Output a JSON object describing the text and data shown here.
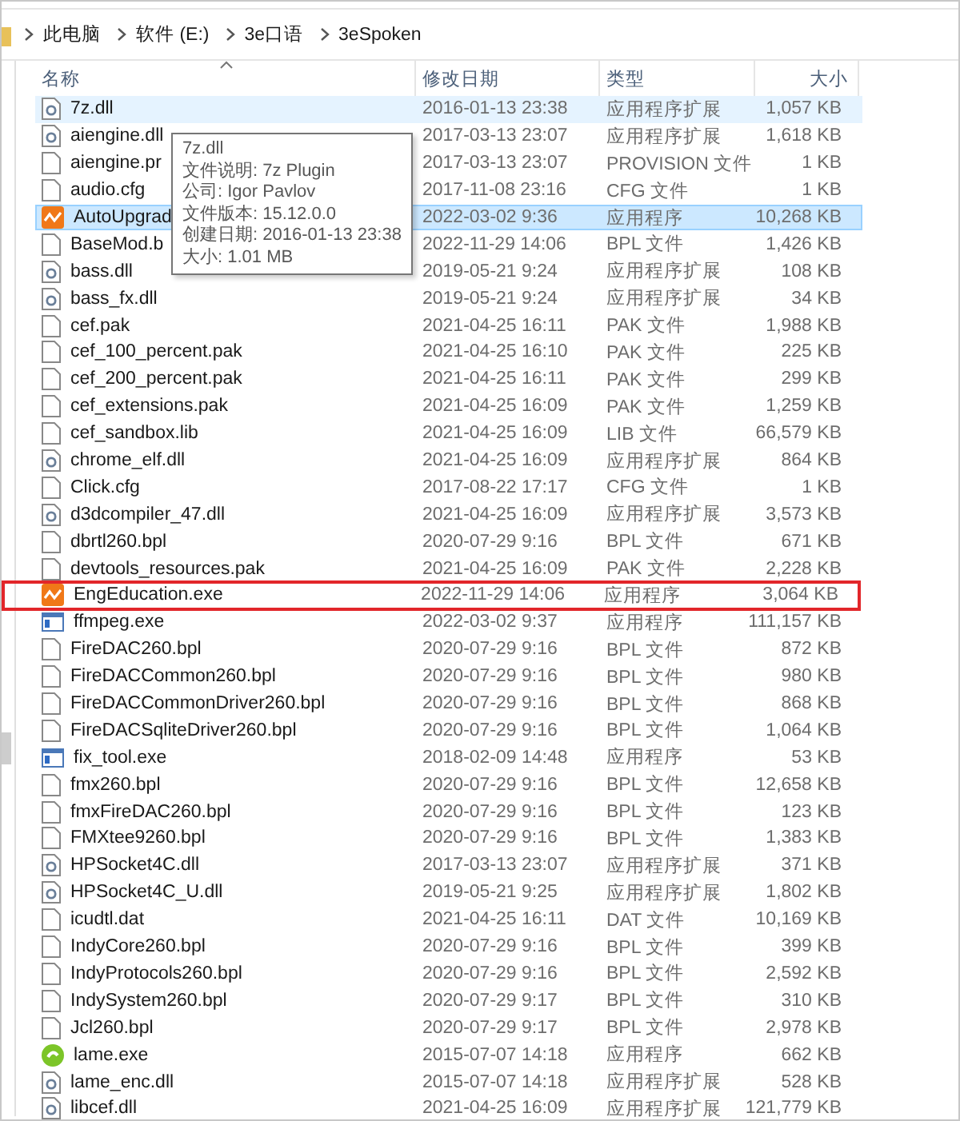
{
  "breadcrumb": [
    "此电脑",
    "软件 (E:)",
    "3e口语",
    "3eSpoken"
  ],
  "columns": [
    {
      "label": "名称",
      "sorted": true
    },
    {
      "label": "修改日期",
      "sorted": false
    },
    {
      "label": "类型",
      "sorted": false
    },
    {
      "label": "大小",
      "sorted": false
    }
  ],
  "rows": [
    {
      "kind": "dll",
      "name": "7z.dll",
      "date": "2016-01-13 23:38",
      "type": "应用程序扩展",
      "size": "1,057 KB",
      "selected": false,
      "hovered": true,
      "outlined": false
    },
    {
      "kind": "dll",
      "name": "aiengine.dll",
      "date": "2017-03-13 23:07",
      "type": "应用程序扩展",
      "size": "1,618 KB",
      "selected": false,
      "hovered": false,
      "outlined": false
    },
    {
      "kind": "file",
      "name": "aiengine.pr",
      "date": "2017-03-13 23:07",
      "type": "PROVISION 文件",
      "size": "1 KB",
      "selected": false,
      "hovered": false,
      "outlined": false
    },
    {
      "kind": "file",
      "name": "audio.cfg",
      "date": "2017-11-08 23:16",
      "type": "CFG 文件",
      "size": "1 KB",
      "selected": false,
      "hovered": false,
      "outlined": false
    },
    {
      "kind": "app",
      "name": "AutoUpgrad",
      "date": "2022-03-02 9:36",
      "type": "应用程序",
      "size": "10,268 KB",
      "selected": true,
      "hovered": false,
      "outlined": false
    },
    {
      "kind": "file",
      "name": "BaseMod.b",
      "date": "2022-11-29 14:06",
      "type": "BPL 文件",
      "size": "1,426 KB",
      "selected": false,
      "hovered": false,
      "outlined": false
    },
    {
      "kind": "dll",
      "name": "bass.dll",
      "date": "2019-05-21 9:24",
      "type": "应用程序扩展",
      "size": "108 KB",
      "selected": false,
      "hovered": false,
      "outlined": false
    },
    {
      "kind": "dll",
      "name": "bass_fx.dll",
      "date": "2019-05-21 9:24",
      "type": "应用程序扩展",
      "size": "34 KB",
      "selected": false,
      "hovered": false,
      "outlined": false
    },
    {
      "kind": "file",
      "name": "cef.pak",
      "date": "2021-04-25 16:11",
      "type": "PAK 文件",
      "size": "1,988 KB",
      "selected": false,
      "hovered": false,
      "outlined": false
    },
    {
      "kind": "file",
      "name": "cef_100_percent.pak",
      "date": "2021-04-25 16:10",
      "type": "PAK 文件",
      "size": "225 KB",
      "selected": false,
      "hovered": false,
      "outlined": false
    },
    {
      "kind": "file",
      "name": "cef_200_percent.pak",
      "date": "2021-04-25 16:11",
      "type": "PAK 文件",
      "size": "299 KB",
      "selected": false,
      "hovered": false,
      "outlined": false
    },
    {
      "kind": "file",
      "name": "cef_extensions.pak",
      "date": "2021-04-25 16:09",
      "type": "PAK 文件",
      "size": "1,259 KB",
      "selected": false,
      "hovered": false,
      "outlined": false
    },
    {
      "kind": "file",
      "name": "cef_sandbox.lib",
      "date": "2021-04-25 16:09",
      "type": "LIB 文件",
      "size": "66,579 KB",
      "selected": false,
      "hovered": false,
      "outlined": false
    },
    {
      "kind": "dll",
      "name": "chrome_elf.dll",
      "date": "2021-04-25 16:09",
      "type": "应用程序扩展",
      "size": "864 KB",
      "selected": false,
      "hovered": false,
      "outlined": false
    },
    {
      "kind": "file",
      "name": "Click.cfg",
      "date": "2017-08-22 17:17",
      "type": "CFG 文件",
      "size": "1 KB",
      "selected": false,
      "hovered": false,
      "outlined": false
    },
    {
      "kind": "dll",
      "name": "d3dcompiler_47.dll",
      "date": "2021-04-25 16:09",
      "type": "应用程序扩展",
      "size": "3,573 KB",
      "selected": false,
      "hovered": false,
      "outlined": false
    },
    {
      "kind": "file",
      "name": "dbrtl260.bpl",
      "date": "2020-07-29 9:16",
      "type": "BPL 文件",
      "size": "671 KB",
      "selected": false,
      "hovered": false,
      "outlined": false
    },
    {
      "kind": "file",
      "name": "devtools_resources.pak",
      "date": "2021-04-25 16:09",
      "type": "PAK 文件",
      "size": "2,228 KB",
      "selected": false,
      "hovered": false,
      "outlined": false
    },
    {
      "kind": "app",
      "name": "EngEducation.exe",
      "date": "2022-11-29 14:06",
      "type": "应用程序",
      "size": "3,064 KB",
      "selected": false,
      "hovered": false,
      "outlined": true
    },
    {
      "kind": "exe",
      "name": "ffmpeg.exe",
      "date": "2022-03-02 9:37",
      "type": "应用程序",
      "size": "111,157 KB",
      "selected": false,
      "hovered": false,
      "outlined": false
    },
    {
      "kind": "file",
      "name": "FireDAC260.bpl",
      "date": "2020-07-29 9:16",
      "type": "BPL 文件",
      "size": "872 KB",
      "selected": false,
      "hovered": false,
      "outlined": false
    },
    {
      "kind": "file",
      "name": "FireDACCommon260.bpl",
      "date": "2020-07-29 9:16",
      "type": "BPL 文件",
      "size": "980 KB",
      "selected": false,
      "hovered": false,
      "outlined": false
    },
    {
      "kind": "file",
      "name": "FireDACCommonDriver260.bpl",
      "date": "2020-07-29 9:16",
      "type": "BPL 文件",
      "size": "868 KB",
      "selected": false,
      "hovered": false,
      "outlined": false
    },
    {
      "kind": "file",
      "name": "FireDACSqliteDriver260.bpl",
      "date": "2020-07-29 9:16",
      "type": "BPL 文件",
      "size": "1,064 KB",
      "selected": false,
      "hovered": false,
      "outlined": false
    },
    {
      "kind": "exe",
      "name": "fix_tool.exe",
      "date": "2018-02-09 14:48",
      "type": "应用程序",
      "size": "53 KB",
      "selected": false,
      "hovered": false,
      "outlined": false
    },
    {
      "kind": "file",
      "name": "fmx260.bpl",
      "date": "2020-07-29 9:16",
      "type": "BPL 文件",
      "size": "12,658 KB",
      "selected": false,
      "hovered": false,
      "outlined": false
    },
    {
      "kind": "file",
      "name": "fmxFireDAC260.bpl",
      "date": "2020-07-29 9:16",
      "type": "BPL 文件",
      "size": "123 KB",
      "selected": false,
      "hovered": false,
      "outlined": false
    },
    {
      "kind": "file",
      "name": "FMXtee9260.bpl",
      "date": "2020-07-29 9:16",
      "type": "BPL 文件",
      "size": "1,383 KB",
      "selected": false,
      "hovered": false,
      "outlined": false
    },
    {
      "kind": "dll",
      "name": "HPSocket4C.dll",
      "date": "2017-03-13 23:07",
      "type": "应用程序扩展",
      "size": "371 KB",
      "selected": false,
      "hovered": false,
      "outlined": false
    },
    {
      "kind": "dll",
      "name": "HPSocket4C_U.dll",
      "date": "2019-05-21 9:25",
      "type": "应用程序扩展",
      "size": "1,802 KB",
      "selected": false,
      "hovered": false,
      "outlined": false
    },
    {
      "kind": "file",
      "name": "icudtl.dat",
      "date": "2021-04-25 16:11",
      "type": "DAT 文件",
      "size": "10,169 KB",
      "selected": false,
      "hovered": false,
      "outlined": false
    },
    {
      "kind": "file",
      "name": "IndyCore260.bpl",
      "date": "2020-07-29 9:16",
      "type": "BPL 文件",
      "size": "399 KB",
      "selected": false,
      "hovered": false,
      "outlined": false
    },
    {
      "kind": "file",
      "name": "IndyProtocols260.bpl",
      "date": "2020-07-29 9:16",
      "type": "BPL 文件",
      "size": "2,592 KB",
      "selected": false,
      "hovered": false,
      "outlined": false
    },
    {
      "kind": "file",
      "name": "IndySystem260.bpl",
      "date": "2020-07-29 9:17",
      "type": "BPL 文件",
      "size": "310 KB",
      "selected": false,
      "hovered": false,
      "outlined": false
    },
    {
      "kind": "file",
      "name": "Jcl260.bpl",
      "date": "2020-07-29 9:17",
      "type": "BPL 文件",
      "size": "2,978 KB",
      "selected": false,
      "hovered": false,
      "outlined": false
    },
    {
      "kind": "green",
      "name": "lame.exe",
      "date": "2015-07-07 14:18",
      "type": "应用程序",
      "size": "662 KB",
      "selected": false,
      "hovered": false,
      "outlined": false
    },
    {
      "kind": "dll",
      "name": "lame_enc.dll",
      "date": "2015-07-07 14:18",
      "type": "应用程序扩展",
      "size": "528 KB",
      "selected": false,
      "hovered": false,
      "outlined": false
    },
    {
      "kind": "dll",
      "name": "libcef.dll",
      "date": "2021-04-25 16:09",
      "type": "应用程序扩展",
      "size": "121,779 KB",
      "selected": false,
      "hovered": false,
      "outlined": false
    }
  ],
  "tooltip": [
    "7z.dll",
    "文件说明: 7z Plugin",
    "公司: Igor Pavlov",
    "文件版本: 15.12.0.0",
    "创建日期: 2016-01-13 23:38",
    "大小: 1.01 MB"
  ]
}
